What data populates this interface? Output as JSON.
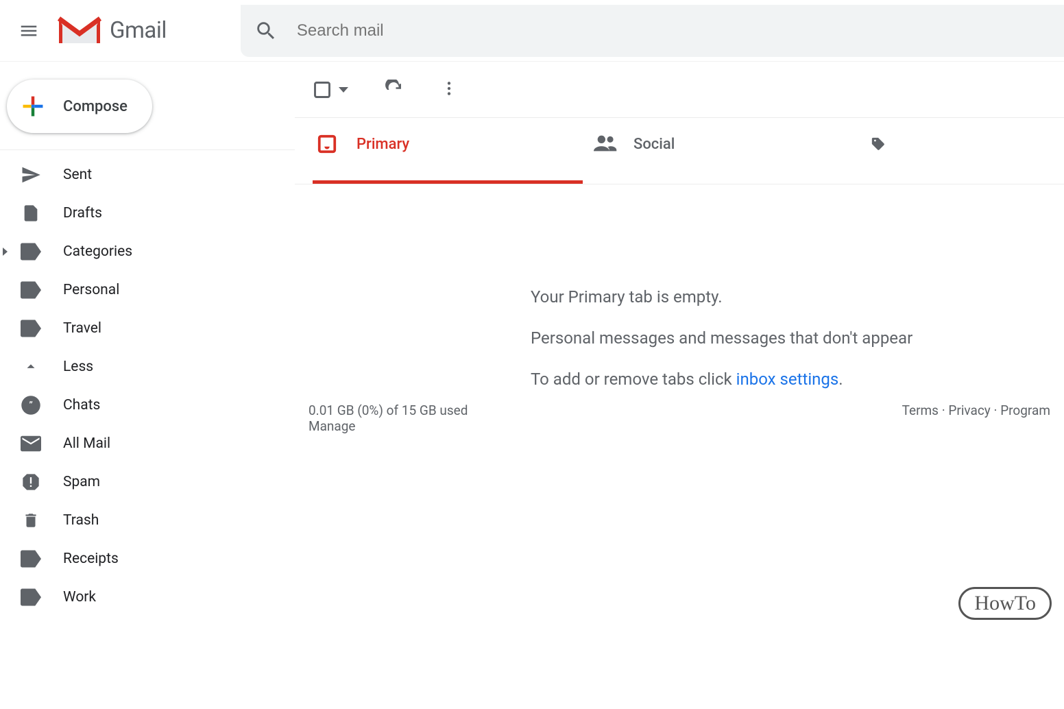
{
  "header": {
    "logo_text": "Gmail",
    "search_placeholder": "Search mail"
  },
  "sidebar": {
    "compose_label": "Compose",
    "items": [
      {
        "label": "Sent",
        "icon": "send"
      },
      {
        "label": "Drafts",
        "icon": "file"
      },
      {
        "label": "Categories",
        "icon": "label",
        "expandable": true
      },
      {
        "label": "Personal",
        "icon": "label"
      },
      {
        "label": "Travel",
        "icon": "label"
      },
      {
        "label": "Less",
        "icon": "collapse"
      },
      {
        "label": "Chats",
        "icon": "chat"
      },
      {
        "label": "All Mail",
        "icon": "mail"
      },
      {
        "label": "Spam",
        "icon": "spam"
      },
      {
        "label": "Trash",
        "icon": "trash"
      },
      {
        "label": "Receipts",
        "icon": "label"
      },
      {
        "label": "Work",
        "icon": "label"
      }
    ]
  },
  "tabs": [
    {
      "label": "Primary",
      "icon": "inbox",
      "active": true
    },
    {
      "label": "Social",
      "icon": "people",
      "active": false
    }
  ],
  "empty_state": {
    "title": "Your Primary tab is empty.",
    "line2": "Personal messages and messages that don't appear",
    "line3_prefix": "To add or remove tabs click ",
    "link_text": "inbox settings",
    "line3_suffix": "."
  },
  "footer": {
    "storage_line": "0.01 GB (0%) of 15 GB used",
    "manage_link": "Manage",
    "terms": "Terms",
    "privacy": "Privacy",
    "program": "Program"
  },
  "watermark": "HowTo"
}
